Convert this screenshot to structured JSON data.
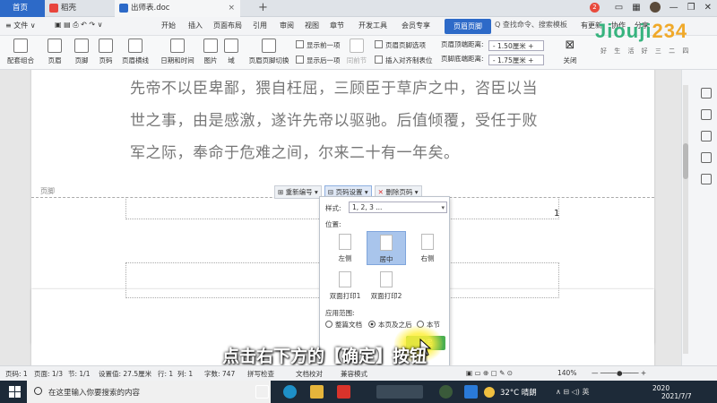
{
  "tabs": {
    "home": "首页",
    "docer": "稻壳",
    "doc": "出师表.doc",
    "add": "+",
    "badge": "2"
  },
  "menu": {
    "file": "≡ 文件 ∨",
    "items": [
      "开始",
      "插入",
      "页面布局",
      "引用",
      "审阅",
      "视图",
      "章节",
      "开发工具",
      "会员专享"
    ],
    "active": "页眉页脚",
    "search": "Q 查找命令、搜索模板",
    "right": [
      "有更新",
      "协作",
      "分享"
    ]
  },
  "logo": {
    "text_a": "Jiouji",
    "text_b": "234",
    "sub": "好 生 活 好 三 二 四"
  },
  "ribbon": {
    "groups": [
      "配套组合",
      "页眉",
      "页脚",
      "页码",
      "页眉横线",
      "日期和时间",
      "图片",
      "域",
      "页眉页脚切换"
    ],
    "show_prev": "显示前一项",
    "show_next": "显示后一项",
    "same_prev": "同前节",
    "options": "页眉页脚选项",
    "align_tab": "插入对齐制表位",
    "header_top_label": "页眉顶端距离:",
    "header_top_value": "1.50厘米",
    "footer_bottom_label": "页脚底端距离:",
    "footer_bottom_value": "1.75厘米",
    "close": "关闭"
  },
  "document": {
    "lines": [
      "先帝不以臣卑鄙，猥自枉屈，三顾臣于草庐之中，咨臣以当",
      "世之事，由是感激，遂许先帝以驱驰。后值倾覆，受任于败",
      "军之际，奉命于危难之间，尔来二十有一年矣。"
    ],
    "footer_label": "页脚",
    "page_number": "1",
    "footer_tools": [
      "重新编号",
      "页码设置",
      "删除页码"
    ]
  },
  "popup": {
    "style_label": "样式:",
    "style_value": "1, 2, 3 ...",
    "position_label": "位置:",
    "positions": [
      "左侧",
      "居中",
      "右侧",
      "双面打印1",
      "双面打印2"
    ],
    "selected_position": "居中",
    "scope_label": "应用范围:",
    "scopes": [
      "整篇文档",
      "本页及之后",
      "本节"
    ],
    "selected_scope": "本页及之后",
    "ok": "确定"
  },
  "subtitle": "点击右下方的【确定】按钮",
  "status": {
    "page": "页码: 1",
    "pages": "页面: 1/3",
    "section": "节: 1/1",
    "setting": "设置值: 27.5厘米",
    "row": "行: 1",
    "col": "列: 1",
    "words": "字数: 747",
    "spell": "拼写检查",
    "doc_check": "文档校对",
    "compat": "兼容模式",
    "zoom": "140%"
  },
  "taskbar": {
    "search_placeholder": "在这里输入你要搜索的内容",
    "temp": "32°C 晴朗",
    "time": "2020",
    "date": "2021/7/7"
  }
}
